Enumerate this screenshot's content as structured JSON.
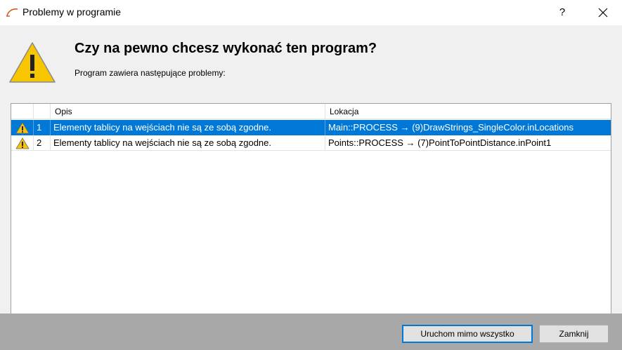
{
  "window": {
    "title": "Problemy w programie",
    "help_label": "?"
  },
  "dialog": {
    "heading": "Czy na pewno chcesz wykonać ten program?",
    "subheading": "Program zawiera następujące problemy:"
  },
  "table": {
    "columns": [
      "",
      "",
      "Opis",
      "Lokacja"
    ],
    "rows": [
      {
        "icon": "warning-icon",
        "number": "1",
        "opis": "Elementy tablicy na wejściach nie są ze sobą zgodne.",
        "lokacja": "Main::PROCESS → (9)DrawStrings_SingleColor.inLocations",
        "selected": true
      },
      {
        "icon": "warning-icon",
        "number": "2",
        "opis": "Elementy tablicy na wejściach nie są ze sobą zgodne.",
        "lokacja": "Points::PROCESS → (7)PointToPointDistance.inPoint1",
        "selected": false
      }
    ]
  },
  "buttons": {
    "run_anyway": "Uruchom mimo wszystko",
    "close": "Zamknij"
  },
  "colors": {
    "selection": "#0078d7",
    "warning_fill": "#f7c600",
    "footer": "#a8a8a8"
  }
}
